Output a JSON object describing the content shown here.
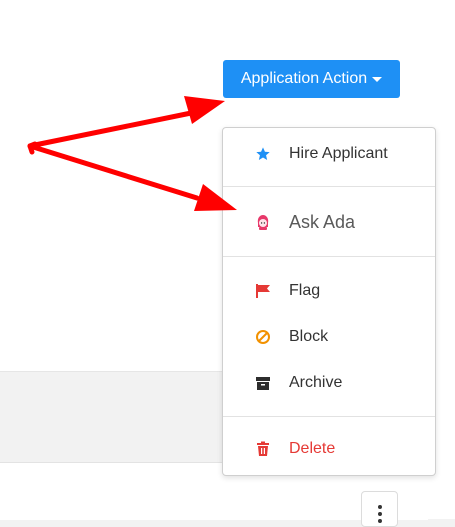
{
  "action_button": {
    "label": "Application Action"
  },
  "menu": {
    "items": [
      {
        "label": "Hire Applicant",
        "icon": "star-icon"
      },
      {
        "label": "Ask Ada",
        "icon": "ada-avatar-icon"
      },
      {
        "label": "Flag",
        "icon": "flag-icon"
      },
      {
        "label": "Block",
        "icon": "block-icon"
      },
      {
        "label": "Archive",
        "icon": "archive-icon"
      },
      {
        "label": "Delete",
        "icon": "trash-icon"
      }
    ]
  },
  "colors": {
    "primary": "#1e90f5",
    "danger": "#e53935",
    "block": "#f29100",
    "flag": "#e53935",
    "ada": "#e8386a",
    "annotation_arrow": "#ff0000"
  }
}
